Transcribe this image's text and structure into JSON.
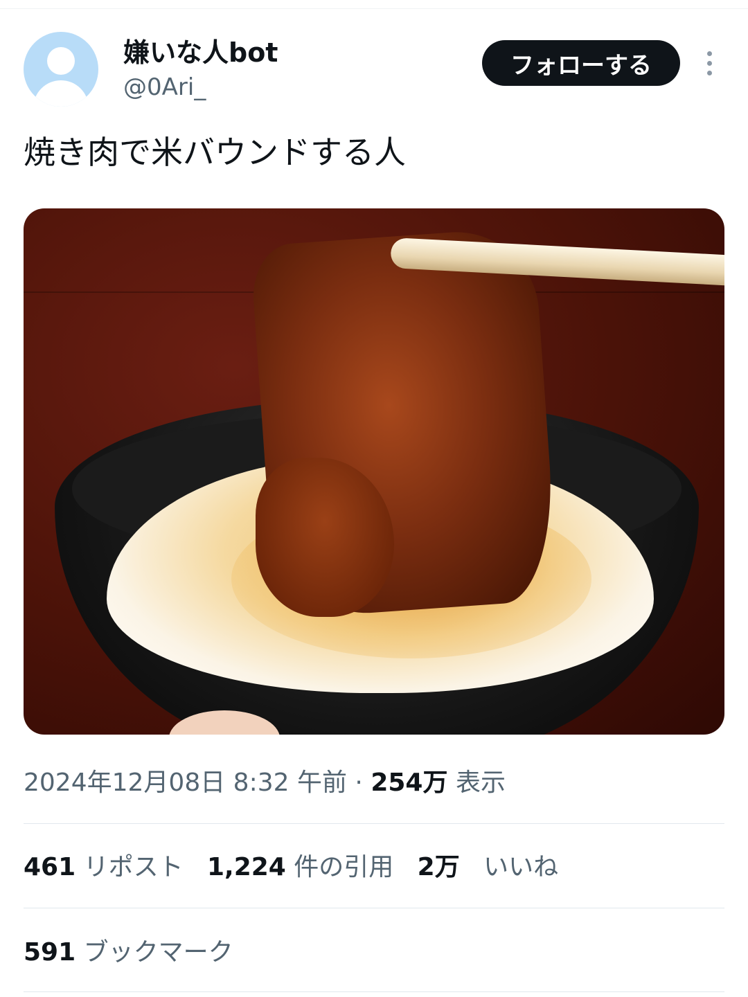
{
  "author": {
    "display_name": "嫌いな人bot",
    "handle": "@0Ari_",
    "follow_label": "フォローする"
  },
  "tweet": {
    "text": "焼き肉で米バウンドする人",
    "media_description_icon": "photo",
    "timestamp": "2024年12月08日 8:32 午前",
    "separator": "·",
    "views_count": "254万",
    "views_label": "表示"
  },
  "engagement": {
    "reposts_count": "461",
    "reposts_label": "リポスト",
    "quotes_count": "1,224",
    "quotes_label": "件の引用",
    "likes_count": "2万",
    "likes_label": "いいね",
    "bookmarks_count": "591",
    "bookmarks_label": "ブックマーク"
  },
  "colors": {
    "text_primary": "#0f1419",
    "text_secondary": "#536471",
    "follow_bg": "#0f1419",
    "avatar_bg": "#b8dcf8",
    "divider": "#e1e8ed"
  }
}
